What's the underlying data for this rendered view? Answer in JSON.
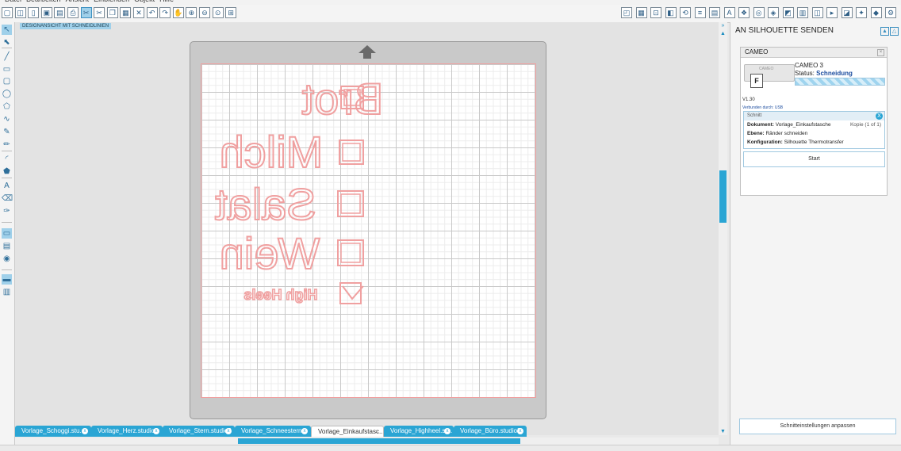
{
  "colors": {
    "accent": "#2aa5d4",
    "cut_line": "#f0a0a0",
    "status_blue": "#1f4fa0"
  },
  "menu": [
    "Datei",
    "Bearbeiten",
    "Ansicht",
    "Einblenden",
    "Objekt",
    "Hilfe"
  ],
  "toolbar_left_icons": [
    "new-file-icon",
    "open-folder-icon",
    "new-page-icon",
    "save-icon",
    "save-to-library-icon",
    "print-icon",
    "send-to-cutter-icon",
    "cut-icon",
    "copy-icon",
    "paste-icon",
    "delete-icon",
    "undo-icon",
    "redo-icon",
    "pan-hand-icon",
    "zoom-in-icon",
    "zoom-out-icon",
    "zoom-drag-icon",
    "fit-to-window-icon"
  ],
  "toolbar_right_icons": [
    "page-setup-icon",
    "grid-icon",
    "registration-icon",
    "fill-icon",
    "transform-icon",
    "line-style-icon",
    "text-style-icon",
    "text-icon",
    "replicate-icon",
    "offset-icon",
    "trace-icon",
    "modify-icon",
    "library-icon",
    "design-store-icon",
    "send-icon",
    "layers-icon",
    "effects-icon",
    "knife-icon",
    "settings-icon"
  ],
  "left_tools": [
    "select-arrow-icon",
    "point-edit-icon",
    "line-icon",
    "rectangle-icon",
    "rounded-rect-icon",
    "ellipse-icon",
    "polygon-icon",
    "curve-icon",
    "freehand-icon",
    "pencil-icon",
    "arc-icon",
    "shape-icon",
    "text-tool-icon",
    "eraser-icon",
    "knife-tool-icon",
    "design-view-icon",
    "library-view-icon",
    "store-icon",
    "single-panel-icon",
    "split-panel-icon"
  ],
  "canvas": {
    "view_label": "DESIGNANSICHT MIT SCHNEIDLINIEN"
  },
  "design": {
    "items": [
      "Brot",
      "Milch",
      "Salat",
      "Wein"
    ],
    "footer": "High Heels"
  },
  "tabs": [
    {
      "label": "Vorlage_Schoggi.stu...",
      "active": false
    },
    {
      "label": "Vorlage_Herz.studio3",
      "active": false
    },
    {
      "label": "Vorlage_Stern.studio3",
      "active": false
    },
    {
      "label": "Vorlage_Schneestern...",
      "active": false
    },
    {
      "label": "Vorlage_Einkaufstasc...",
      "active": true
    },
    {
      "label": "Vorlage_Highheel.st...",
      "active": false
    },
    {
      "label": "Vorlage_Büro.studio3",
      "active": false
    }
  ],
  "panel": {
    "title": "AN SILHOUETTE SENDEN",
    "device_header": "CAMEO",
    "cutter_label": "CAMEO",
    "doc_icon_letter": "F",
    "device_name": "CAMEO 3",
    "status_label": "Status:",
    "status_value": "Schneidung",
    "version": "V1.30",
    "connection": "Verbunden durch: USB",
    "job": {
      "header": "Schnitt",
      "document_label": "Dokument:",
      "document_value": "Vorlage_Einkaufstasche",
      "copies": "Kopie (1 of 1)",
      "layer_label": "Ebene:",
      "layer_value": "Ränder schneiden",
      "config_label": "Konfiguration:",
      "config_value": "Silhouette Thermotransfer"
    },
    "start_label": "Start",
    "adjust_label": "Schnitteinstellungen anpassen"
  }
}
